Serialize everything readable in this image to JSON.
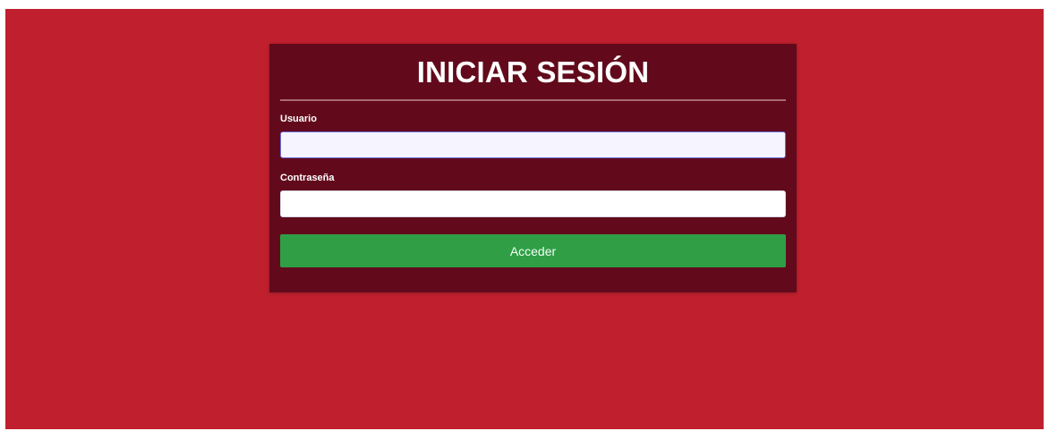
{
  "colors": {
    "page_background": "#c0202e",
    "card_background": "#620a1b",
    "button_background": "#2f9e45",
    "text": "#ffffff"
  },
  "login": {
    "title": "INICIAR SESIÓN",
    "username_label": "Usuario",
    "username_value": "",
    "password_label": "Contraseña",
    "password_value": "",
    "submit_label": "Acceder"
  }
}
